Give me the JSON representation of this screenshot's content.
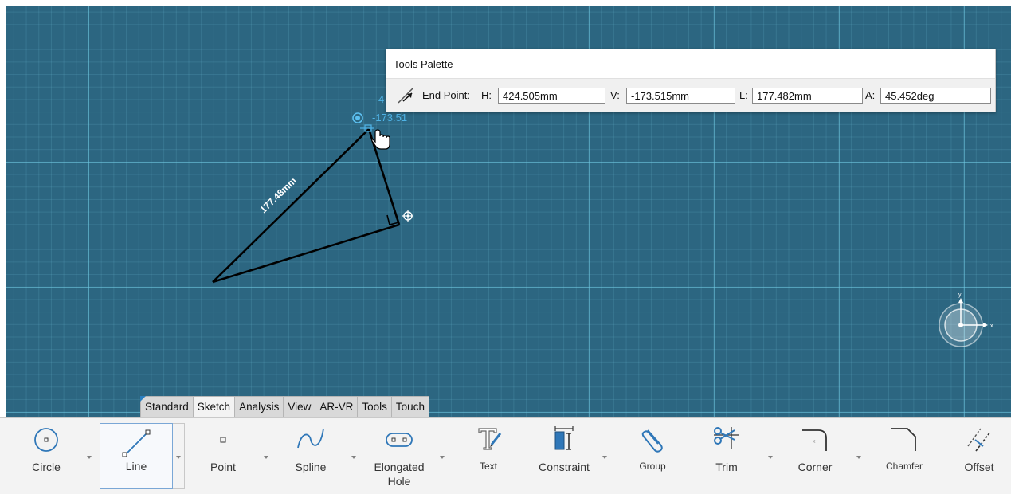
{
  "canvas": {
    "dimension_label": "177.48mm",
    "cursor_readout_v": "-173.51",
    "cursor_readout_h": "4"
  },
  "tools_palette": {
    "title": "Tools Palette",
    "end_point_label": "End Point:",
    "h_label": "H:",
    "h_value": "424.505mm",
    "v_label": "V:",
    "v_value": "-173.515mm",
    "l_label": "L:",
    "l_value": "177.482mm",
    "a_label": "A:",
    "a_value": "45.452deg"
  },
  "tabs": [
    {
      "label": "Standard",
      "active": false
    },
    {
      "label": "Sketch",
      "active": true
    },
    {
      "label": "Analysis",
      "active": false
    },
    {
      "label": "View",
      "active": false
    },
    {
      "label": "AR-VR",
      "active": false
    },
    {
      "label": "Tools",
      "active": false
    },
    {
      "label": "Touch",
      "active": false
    }
  ],
  "ribbon": {
    "circle": "Circle",
    "line": "Line",
    "point": "Point",
    "spline": "Spline",
    "elongated_hole_1": "Elongated",
    "elongated_hole_2": "Hole",
    "text": "Text",
    "constraint": "Constraint",
    "group": "Group",
    "trim": "Trim",
    "corner": "Corner",
    "chamfer": "Chamfer",
    "offset": "Offset"
  },
  "colors": {
    "canvas_bg": "#2c6681",
    "grid_major": "#6ec8e1",
    "highlight": "#4fb3e6",
    "sketch_line": "#000000"
  }
}
